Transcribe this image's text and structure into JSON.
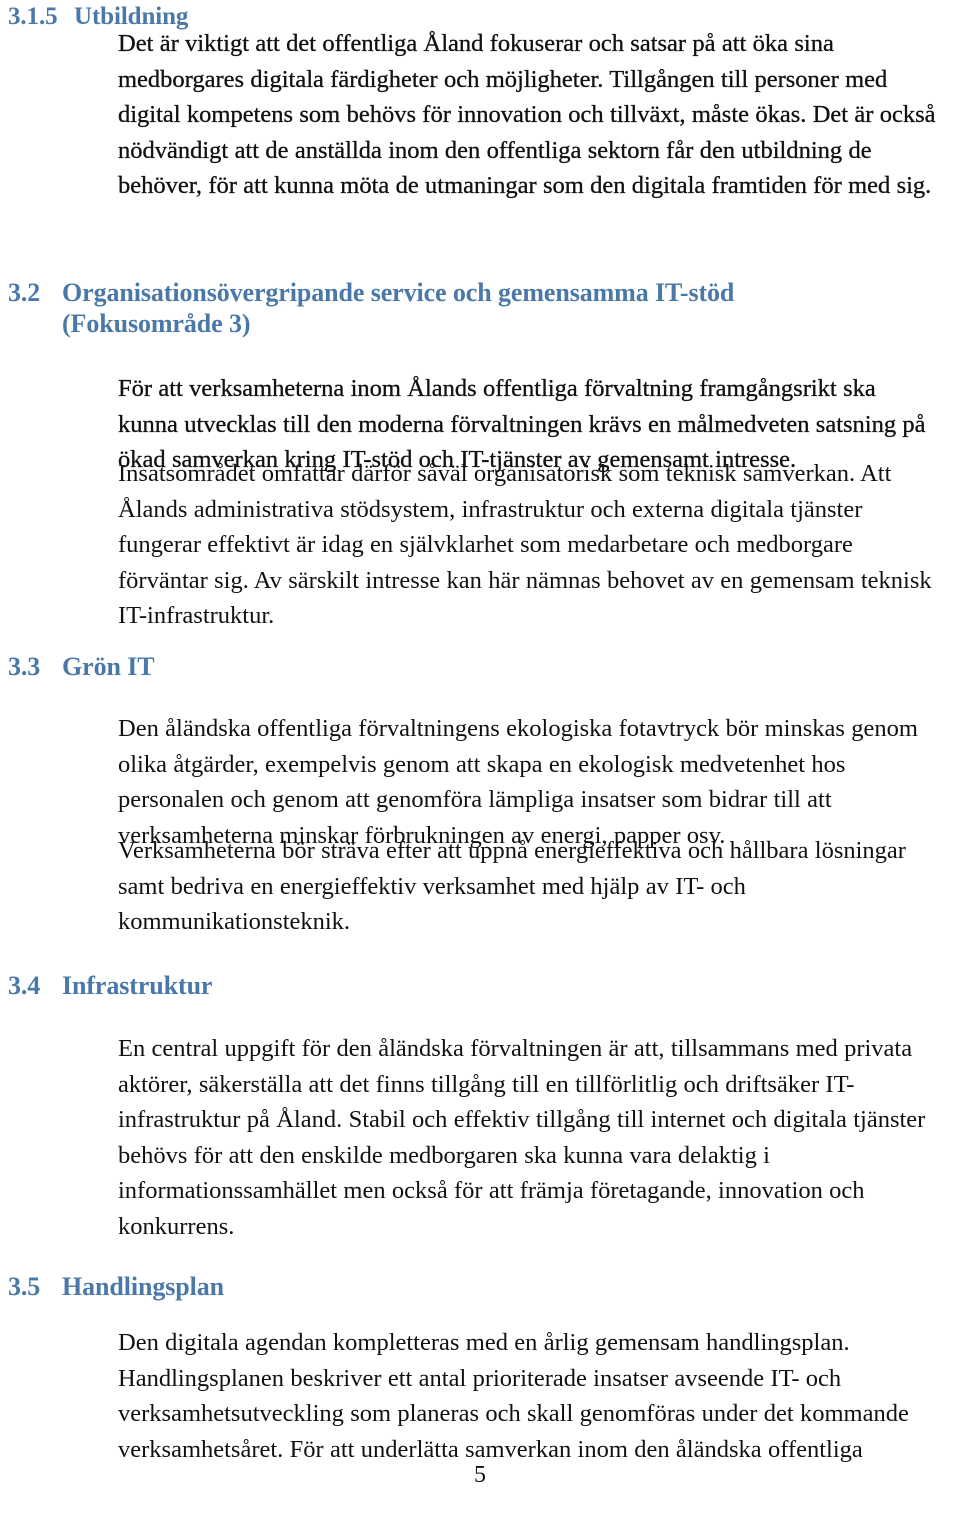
{
  "document": {
    "page_number": "5",
    "heading_color": "#4a78a9",
    "body_color": "#111111",
    "background_color": "#ffffff"
  },
  "sections": [
    {
      "number": "3.1.5",
      "title": "Utbildning",
      "level": 3,
      "body": "Det är viktigt att det offentliga Åland fokuserar och satsar på att öka sina\nmedborgares digitala färdigheter och möjligheter. Tillgången till personer med\ndigital kompetens som behövs för innovation och tillväxt, måste ökas. Det är också\nnödvändigt att de anställda inom den offentliga sektorn får den utbildning de\nbehöver, för att kunna möta de utmaningar som den digitala framtiden för med sig."
    },
    {
      "number": "3.2",
      "title": "Organisationsövergripande service och gemensamma IT-stöd\n(Fokusområde 3)",
      "level": 2,
      "body_part_1": "För att verksamheterna inom Ålands offentliga förvaltning framgångsrikt ska\nkunna utvecklas till den moderna förvaltningen krävs en målmedveten satsning på\nökad samverkan kring IT-stöd och IT-tjänster av gemensamt intresse.",
      "body_part_2": "Insatsområdet omfattar därför såväl organisatorisk som teknisk samverkan.  Att\nÅlands administrativa stödsystem, infrastruktur och externa digitala tjänster\nfungerar effektivt är idag en självklarhet som medarbetare och medborgare\nförväntar sig. Av särskilt intresse kan här nämnas behovet av en gemensam teknisk\nIT-infrastruktur."
    },
    {
      "number": "3.3",
      "title": "Grön IT",
      "level": 2,
      "body_part_1": "Den åländska offentliga förvaltningens ekologiska fotavtryck bör minskas genom\nolika åtgärder, exempelvis genom att skapa en ekologisk medvetenhet hos\npersonalen och genom att genomföra lämpliga insatser som bidrar till att\nverksamheterna minskar förbrukningen av energi, papper osv.",
      "body_part_2": "Verksamheterna bör sträva efter att uppnå energieffektiva och hållbara lösningar\nsamt bedriva en energieffektiv verksamhet med hjälp av IT- och\nkommunikationsteknik."
    },
    {
      "number": "3.4",
      "title": "Infrastruktur",
      "level": 2,
      "body": "En central uppgift för den åländska förvaltningen är att, tillsammans med privata\naktörer, säkerställa att det finns tillgång till en tillförlitlig och driftsäker IT-\ninfrastruktur på Åland. Stabil och effektiv tillgång till internet och digitala tjänster\nbehövs för att den enskilde medborgaren ska kunna vara delaktig i\ninformationssamhället men också för att främja företagande, innovation och\nkonkurrens."
    },
    {
      "number": "3.5",
      "title": "Handlingsplan",
      "level": 2,
      "body": "Den digitala agendan kompletteras med en årlig gemensam handlingsplan.\nHandlingsplanen beskriver ett antal prioriterade insatser avseende IT- och\nverksamhetsutveckling som planeras och skall genomföras under det kommande\nverksamhetsåret. För att underlätta samverkan inom den åländska offentliga"
    }
  ]
}
